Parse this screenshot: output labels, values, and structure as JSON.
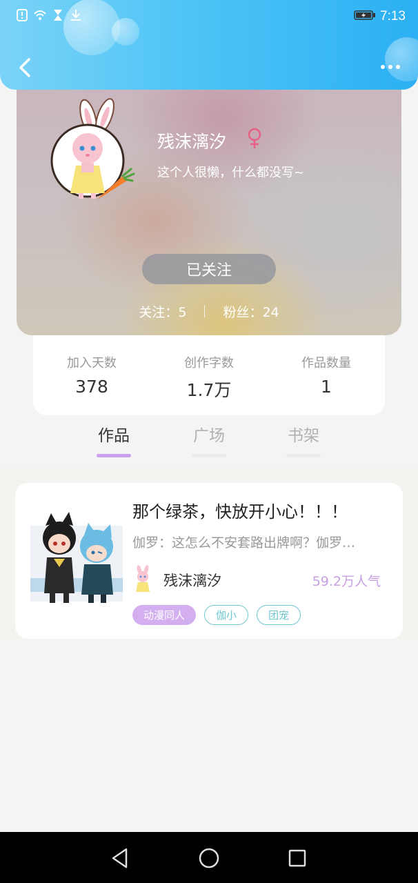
{
  "status_bar": {
    "time": "7:13",
    "left_icons": [
      "alert-icon",
      "wifi-icon",
      "hourglass-icon",
      "download-icon"
    ],
    "right_icons": [
      "battery-icon"
    ]
  },
  "header": {
    "back_icon": "chevron-left-icon",
    "more_icon": "more-dots-icon",
    "colors": {
      "start": "#7ad3f7",
      "end": "#2bb0f3"
    }
  },
  "profile": {
    "name": "残沫漓汐",
    "gender_icon": "female-icon",
    "gender_color": "#e85f86",
    "bio": "这个人很懒，什么都没写~",
    "follow_button": "已关注",
    "following_label": "关注：5",
    "followers_label": "粉丝：24"
  },
  "stats": [
    {
      "label": "加入天数",
      "value": "378"
    },
    {
      "label": "创作字数",
      "value": "1.7万"
    },
    {
      "label": "作品数量",
      "value": "1"
    }
  ],
  "tabs": [
    {
      "label": "作品",
      "active": true
    },
    {
      "label": "广场",
      "active": false
    },
    {
      "label": "书架",
      "active": false
    }
  ],
  "works": [
    {
      "title": "那个绿茶，快放开小心！！！",
      "description": "伽罗：这怎么不安套路出牌啊？伽罗…",
      "author": "残沫漓汐",
      "popularity": "59.2万人气",
      "tags": [
        "动漫同人",
        "伽小",
        "团宠"
      ]
    }
  ],
  "nav_bar": {
    "buttons": [
      "back-triangle-icon",
      "home-circle-icon",
      "recents-square-icon"
    ]
  },
  "accent_colors": {
    "tab_active": "#c9a0ec",
    "popularity": "#c79fe0",
    "tag_filled": "#d3aff0",
    "tag_outline": "#6ec6d0"
  }
}
